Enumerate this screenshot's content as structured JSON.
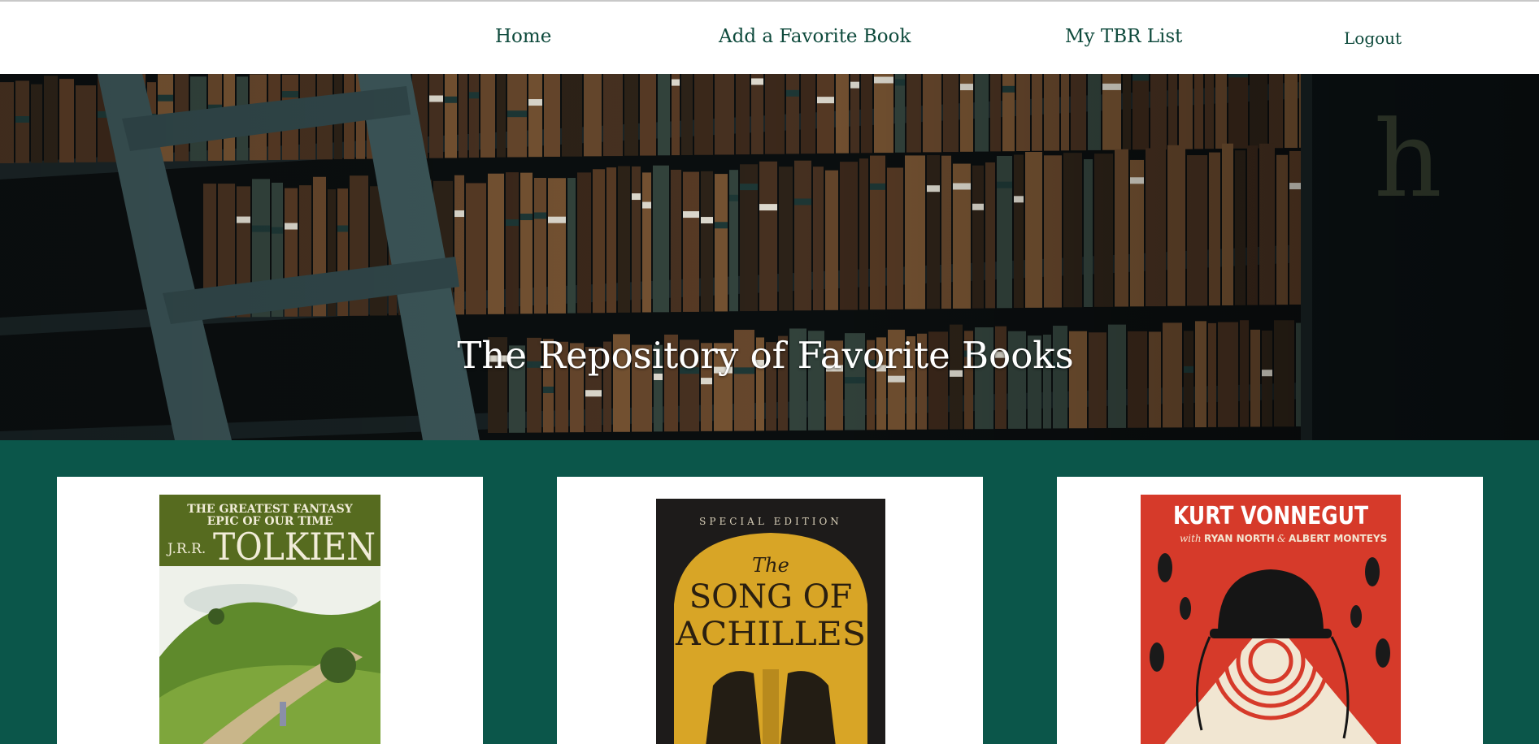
{
  "nav": {
    "home": "Home",
    "add_favorite": "Add a Favorite Book",
    "tbr_list": "My TBR List",
    "logout": "Logout"
  },
  "hero": {
    "title": "The Repository of Favorite Books",
    "shelf_letter": "h"
  },
  "books": [
    {
      "cover": {
        "top_text_1": "THE GREATEST FANTASY",
        "top_text_2": "EPIC OF OUR TIME",
        "author_initials": "J.R.R.",
        "author_name": "TOLKIEN"
      }
    },
    {
      "cover": {
        "edition": "SPECIAL EDITION",
        "the": "The",
        "title_line_1": "SONG OF",
        "title_line_2": "ACHILLES"
      }
    },
    {
      "cover": {
        "author_name": "KURT VONNEGUT",
        "with_label": "with",
        "collaborators": "RYAN NORTH",
        "ampersand": "&",
        "collaborator_2": "ALBERT MONTEYS"
      }
    }
  ],
  "colors": {
    "nav_link": "#0e4a3c",
    "main_background": "#0b564a",
    "card_background": "#ffffff"
  }
}
